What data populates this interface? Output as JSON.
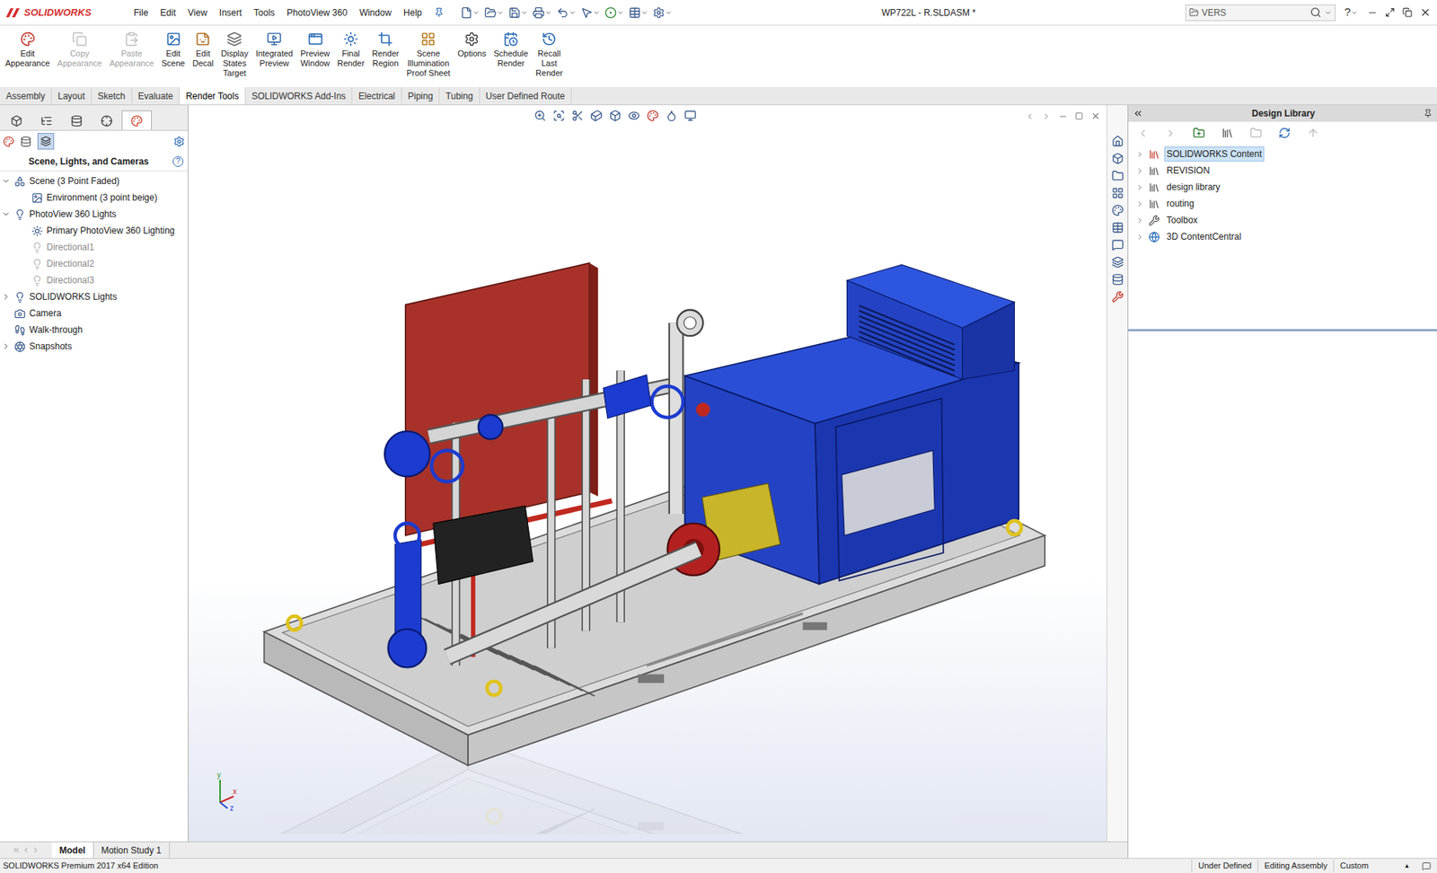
{
  "window": {
    "title": "WP722L - R.SLDASM *",
    "app": "SOLIDWORKS"
  },
  "menu": [
    "File",
    "Edit",
    "View",
    "Insert",
    "Tools",
    "PhotoView 360",
    "Window",
    "Help"
  ],
  "search": {
    "value": "VERS"
  },
  "help": "?",
  "ribbon": [
    {
      "lines": [
        "Edit",
        "Appearance"
      ],
      "disabled": false
    },
    {
      "lines": [
        "Copy",
        "Appearance"
      ],
      "disabled": true
    },
    {
      "lines": [
        "Paste",
        "Appearance"
      ],
      "disabled": true
    },
    {
      "lines": [
        "Edit",
        "Scene"
      ],
      "disabled": false
    },
    {
      "lines": [
        "Edit",
        "Decal"
      ],
      "disabled": false
    },
    {
      "lines": [
        "Display",
        "States",
        "Target"
      ],
      "disabled": false
    },
    {
      "lines": [
        "Integrated",
        "Preview"
      ],
      "disabled": false
    },
    {
      "lines": [
        "Preview",
        "Window"
      ],
      "disabled": false
    },
    {
      "lines": [
        "Final",
        "Render"
      ],
      "disabled": false
    },
    {
      "lines": [
        "Render",
        "Region"
      ],
      "disabled": false
    },
    {
      "lines": [
        "Scene",
        "Illumination",
        "Proof Sheet"
      ],
      "disabled": false
    },
    {
      "lines": [
        "Options"
      ],
      "disabled": false
    },
    {
      "lines": [
        "Schedule",
        "Render"
      ],
      "disabled": false
    },
    {
      "lines": [
        "Recall",
        "Last",
        "Render"
      ],
      "disabled": false
    }
  ],
  "command_tabs": [
    {
      "label": "Assembly",
      "selected": false
    },
    {
      "label": "Layout",
      "selected": false
    },
    {
      "label": "Sketch",
      "selected": false
    },
    {
      "label": "Evaluate",
      "selected": false
    },
    {
      "label": "Render Tools",
      "selected": true
    },
    {
      "label": "SOLIDWORKS Add-Ins",
      "selected": false
    },
    {
      "label": "Electrical",
      "selected": false
    },
    {
      "label": "Piping",
      "selected": false
    },
    {
      "label": "Tubing",
      "selected": false
    },
    {
      "label": "User Defined Route",
      "selected": false
    }
  ],
  "left_tabs": [
    {
      "selected": false
    },
    {
      "selected": false
    },
    {
      "selected": false
    },
    {
      "selected": false
    },
    {
      "selected": true
    }
  ],
  "left_panel": {
    "title": "Scene, Lights, and Cameras",
    "help": "?",
    "tree": [
      {
        "label": "Scene (3 Point Faded)",
        "level": 0,
        "has_children": true,
        "expanded": true,
        "disabled": false
      },
      {
        "label": "Environment (3 point beige)",
        "level": 1,
        "has_children": false,
        "expanded": false,
        "disabled": false
      },
      {
        "label": "PhotoView 360 Lights",
        "level": 0,
        "has_children": true,
        "expanded": true,
        "disabled": false
      },
      {
        "label": "Primary PhotoView 360 Lighting",
        "level": 1,
        "has_children": false,
        "expanded": false,
        "disabled": false
      },
      {
        "label": "Directional1",
        "level": 1,
        "has_children": false,
        "expanded": false,
        "disabled": true
      },
      {
        "label": "Directional2",
        "level": 1,
        "has_children": false,
        "expanded": false,
        "disabled": true
      },
      {
        "label": "Directional3",
        "level": 1,
        "has_children": false,
        "expanded": false,
        "disabled": true
      },
      {
        "label": "SOLIDWORKS Lights",
        "level": 0,
        "has_children": true,
        "expanded": false,
        "disabled": false
      },
      {
        "label": "Camera",
        "level": 0,
        "has_children": false,
        "expanded": false,
        "disabled": false
      },
      {
        "label": "Walk-through",
        "level": 0,
        "has_children": false,
        "expanded": false,
        "disabled": false
      },
      {
        "label": "Snapshots",
        "level": 0,
        "has_children": true,
        "expanded": false,
        "disabled": false
      }
    ]
  },
  "design_library": {
    "title": "Design Library",
    "items": [
      {
        "label": "SOLIDWORKS Content",
        "selected": true,
        "expanded": false
      },
      {
        "label": "REVISION",
        "selected": false,
        "expanded": false
      },
      {
        "label": "design library",
        "selected": false,
        "expanded": false
      },
      {
        "label": "routing",
        "selected": false,
        "expanded": false
      },
      {
        "label": "Toolbox",
        "selected": false,
        "expanded": false
      },
      {
        "label": "3D ContentCentral",
        "selected": false,
        "expanded": false
      }
    ]
  },
  "triad": [
    "x",
    "y",
    "z"
  ],
  "bottom_tabs": [
    {
      "label": "Model",
      "selected": true
    },
    {
      "label": "Motion Study 1",
      "selected": false
    }
  ],
  "status_bar": {
    "edition": "SOLIDWORKS Premium 2017 x64 Edition",
    "items": [
      "Under Defined",
      "Editing Assembly"
    ],
    "units": "Custom",
    "units_arrow": "▲"
  }
}
